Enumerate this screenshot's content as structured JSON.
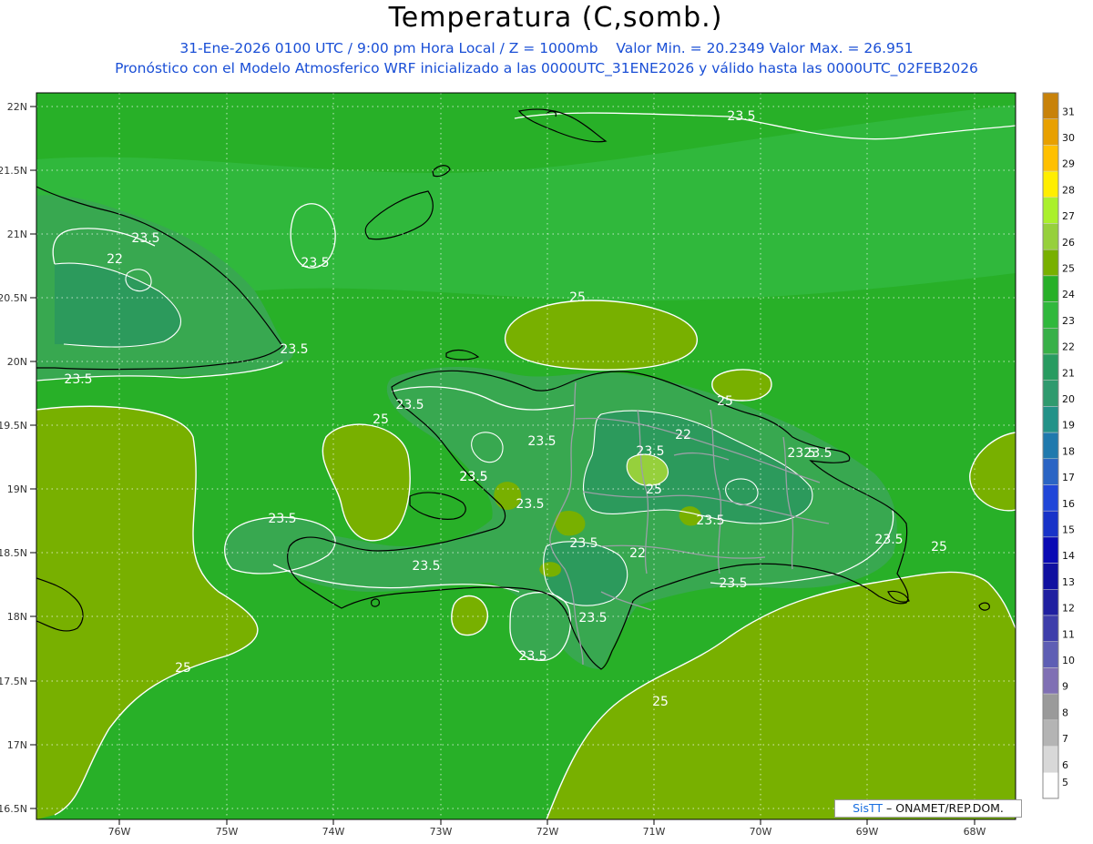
{
  "header": {
    "title": "Temperatura (C,somb.)",
    "subtitle_left": "31-Ene-2026 0100 UTC / 9:00 pm Hora Local / Z = 1000mb",
    "subtitle_right": "Valor Min. = 20.2349 Valor Max. = 26.951",
    "subtitle2": "Pronóstico con el Modelo Atmosferico WRF inicializado a las 0000UTC_31ENE2026 y válido hasta las 0000UTC_02FEB2026"
  },
  "credit": {
    "brand": "SisTT",
    "text": "– ONAMET/REP.DOM."
  },
  "axes": {
    "lat_labels": [
      "22N",
      "21.5N",
      "21N",
      "20.5N",
      "20N",
      "19.5N",
      "19N",
      "18.5N",
      "18N",
      "17.5N",
      "17N",
      "16.5N"
    ],
    "lon_labels": [
      "76W",
      "75W",
      "74W",
      "73W",
      "72W",
      "71W",
      "70W",
      "69W",
      "68W"
    ]
  },
  "legend": {
    "labels": [
      "31",
      "30",
      "29",
      "28",
      "27",
      "26",
      "25",
      "24",
      "23",
      "22",
      "21",
      "20",
      "19",
      "18",
      "17",
      "16",
      "15",
      "14",
      "13",
      "12",
      "11",
      "10",
      "9",
      "8",
      "7",
      "6",
      "5"
    ],
    "colors": [
      "#c8820a",
      "#e8a000",
      "#ffc000",
      "#ffee00",
      "#aaf02c",
      "#96d03c",
      "#78b000",
      "#28b028",
      "#30b83c",
      "#38b048",
      "#289b60",
      "#2f9a6e",
      "#239288",
      "#2079ad",
      "#2a64c4",
      "#2046d8",
      "#1832c8",
      "#0a0ab4",
      "#1010a0",
      "#2020a0",
      "#3e3eaa",
      "#5e5eb4",
      "#8070b4",
      "#9a9a9a",
      "#b4b4b4",
      "#d8d8d8",
      "#ffffff"
    ]
  },
  "contour_labels": [
    {
      "text": "23.5"
    },
    {
      "text": "23.5"
    },
    {
      "text": "23.5"
    },
    {
      "text": "22"
    },
    {
      "text": "23.5"
    },
    {
      "text": "23.5"
    },
    {
      "text": "25"
    },
    {
      "text": "23.5"
    },
    {
      "text": "25"
    },
    {
      "text": "23.5"
    },
    {
      "text": "23.5"
    },
    {
      "text": "23.5"
    },
    {
      "text": "23.5"
    },
    {
      "text": "22"
    },
    {
      "text": "23.5"
    },
    {
      "text": "25"
    },
    {
      "text": "23.5"
    },
    {
      "text": "23.5"
    },
    {
      "text": "23.5"
    },
    {
      "text": "25"
    },
    {
      "text": "23.5"
    },
    {
      "text": "23.5"
    },
    {
      "text": "23.5"
    },
    {
      "text": "22"
    },
    {
      "text": "23.5"
    },
    {
      "text": "23.5"
    },
    {
      "text": "23.5"
    },
    {
      "text": "23.5"
    },
    {
      "text": "25"
    },
    {
      "text": "25"
    },
    {
      "text": "25"
    }
  ]
}
